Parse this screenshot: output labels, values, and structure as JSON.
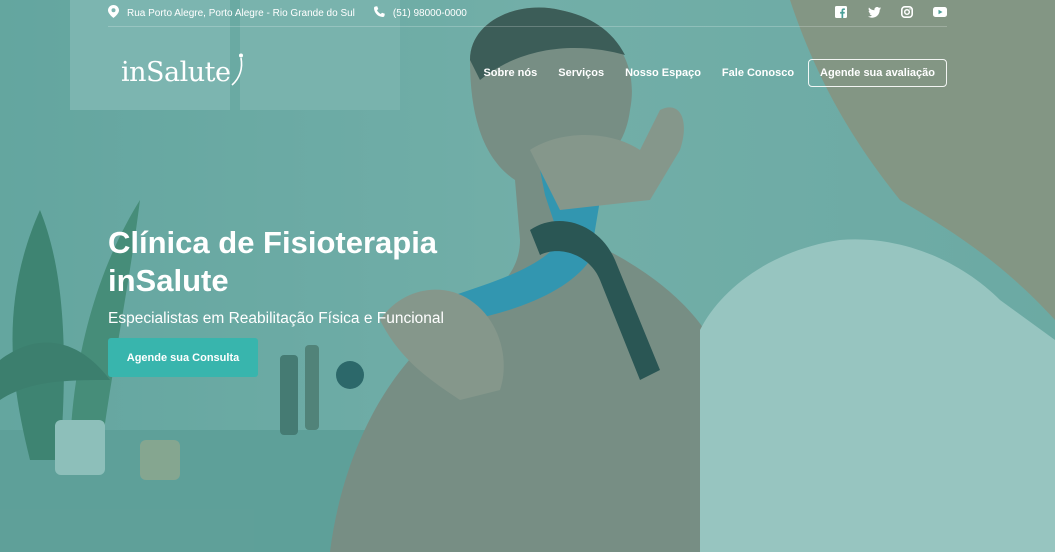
{
  "topbar": {
    "address": "Rua Porto Alegre, Porto Alegre - Rio Grande do Sul",
    "phone": "(51) 98000-0000",
    "social_icons": [
      "facebook-icon",
      "twitter-icon",
      "instagram-icon",
      "youtube-icon"
    ]
  },
  "logo": {
    "text": "inSalute"
  },
  "nav": {
    "items": [
      {
        "label": "Sobre nós"
      },
      {
        "label": "Serviços"
      },
      {
        "label": "Nosso Espaço"
      },
      {
        "label": "Fale Conosco"
      }
    ],
    "cta_label": "Agende sua avaliação"
  },
  "hero": {
    "title_line1": "Clínica de Fisioterapia",
    "title_line2": "inSalute",
    "subtitle": "Especialistas em Reabilitação Física e Funcional",
    "button_label": "Agende sua Consulta"
  },
  "colors": {
    "overlay": "#2f8c84",
    "button": "#38b5ad",
    "text": "#ffffff"
  }
}
